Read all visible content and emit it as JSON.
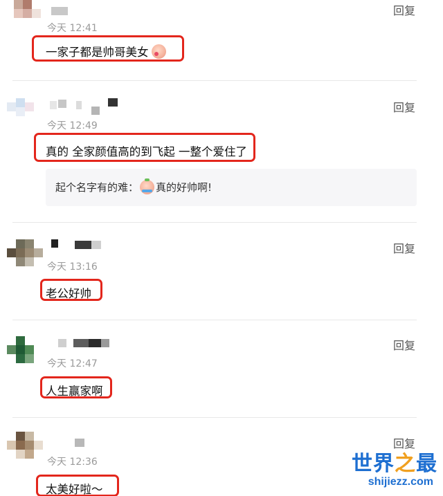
{
  "comments": [
    {
      "time": "今天 12:41",
      "reply": "回复",
      "text": "一家子都是帅哥美女",
      "emoji": "blush-face-emoji"
    },
    {
      "time": "今天 12:49",
      "reply": "回复",
      "text": "真的 全家颜值高的到飞起 一整个爱住了",
      "sub_reply": {
        "prefix": "起个名字有的难：",
        "emoji": "crying-face-emoji",
        "suffix": "真的好帅啊!"
      }
    },
    {
      "time": "今天 13:16",
      "reply": "回复",
      "text": "老公好帅"
    },
    {
      "time": "今天 12:47",
      "reply": "回复",
      "text": "人生赢家啊"
    },
    {
      "time": "今天 12:36",
      "reply": "回复",
      "text": "太美好啦～"
    }
  ],
  "watermark": {
    "main_a": "世界",
    "main_b": "之",
    "main_c": "最",
    "url": "shijiezz.com"
  },
  "colors": {
    "highlight": "#e3261c",
    "watermark": "#1e6fd1",
    "watermark_accent": "#f0a020"
  }
}
